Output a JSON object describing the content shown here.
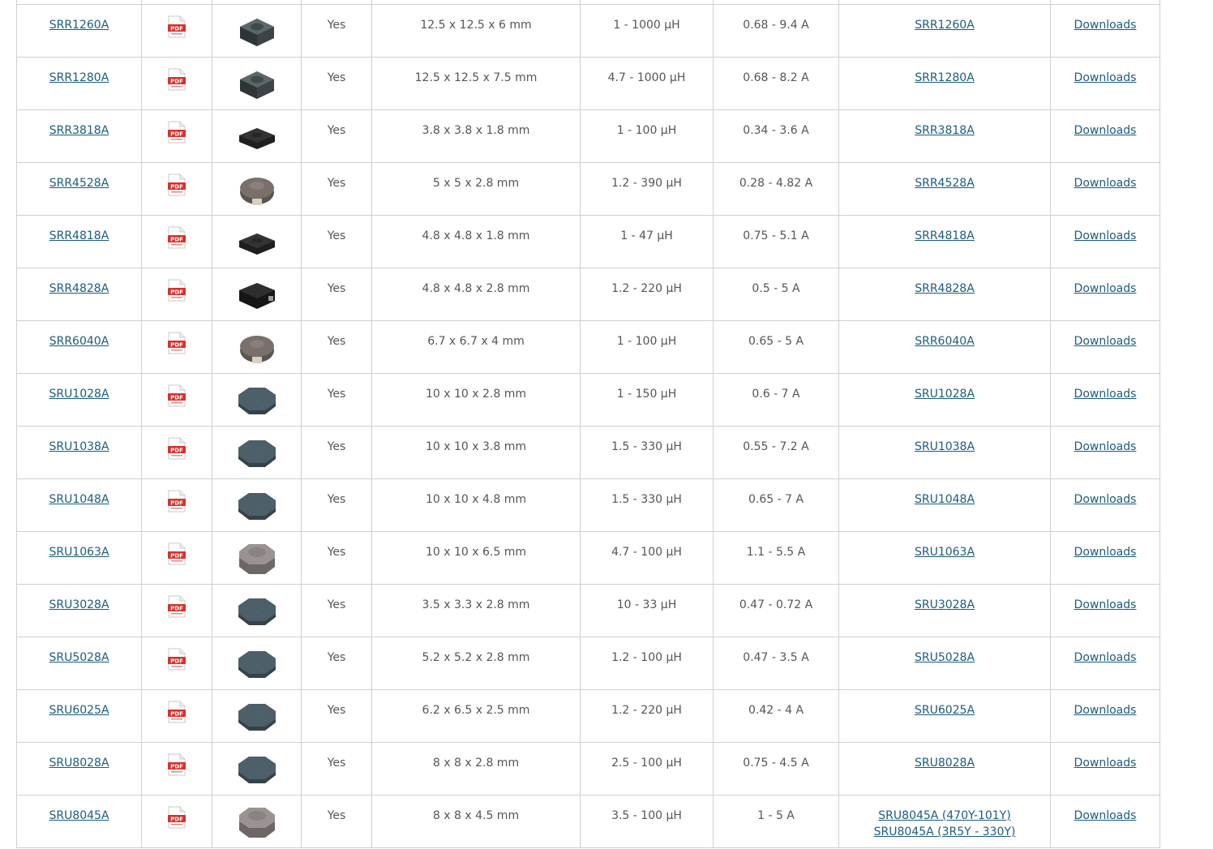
{
  "rows": [
    {
      "part": "SRR1260A",
      "aec": "Yes",
      "size": "12.5 x 12.5 x 6 mm",
      "inductance": "1 - 1000 µH",
      "current": "0.68 - 9.4 A",
      "models": [
        "SRR1260A"
      ],
      "downloads": "Downloads",
      "shape": "sq-dark"
    },
    {
      "part": "SRR1280A",
      "aec": "Yes",
      "size": "12.5 x 12.5 x 7.5 mm",
      "inductance": "4.7 - 1000 µH",
      "current": "0.68 - 8.2 A",
      "models": [
        "SRR1280A"
      ],
      "downloads": "Downloads",
      "shape": "sq-dark"
    },
    {
      "part": "SRR3818A",
      "aec": "Yes",
      "size": "3.8 x 3.8 x 1.8 mm",
      "inductance": "1 - 100 µH",
      "current": "0.34 - 3.6 A",
      "models": [
        "SRR3818A"
      ],
      "downloads": "Downloads",
      "shape": "flat-black"
    },
    {
      "part": "SRR4528A",
      "aec": "Yes",
      "size": "5 x 5 x 2.8 mm",
      "inductance": "1.2 - 390 µH",
      "current": "0.28 - 4.82 A",
      "models": [
        "SRR4528A"
      ],
      "downloads": "Downloads",
      "shape": "round-brown"
    },
    {
      "part": "SRR4818A",
      "aec": "Yes",
      "size": "4.8 x 4.8 x 1.8 mm",
      "inductance": "1 - 47 µH",
      "current": "0.75 - 5.1 A",
      "models": [
        "SRR4818A"
      ],
      "downloads": "Downloads",
      "shape": "flat-black"
    },
    {
      "part": "SRR4828A",
      "aec": "Yes",
      "size": "4.8 x 4.8 x 2.8 mm",
      "inductance": "1.2 - 220 µH",
      "current": "0.5 - 5 A",
      "models": [
        "SRR4828A"
      ],
      "downloads": "Downloads",
      "shape": "block-black"
    },
    {
      "part": "SRR6040A",
      "aec": "Yes",
      "size": "6.7 x 6.7 x 4 mm",
      "inductance": "1 - 100 µH",
      "current": "0.65 - 5 A",
      "models": [
        "SRR6040A"
      ],
      "downloads": "Downloads",
      "shape": "round-brown"
    },
    {
      "part": "SRU1028A",
      "aec": "Yes",
      "size": "10 x 10 x 2.8 mm",
      "inductance": "1 - 150 µH",
      "current": "0.6 - 7 A",
      "models": [
        "SRU1028A"
      ],
      "downloads": "Downloads",
      "shape": "oct-slate"
    },
    {
      "part": "SRU1038A",
      "aec": "Yes",
      "size": "10 x 10 x 3.8 mm",
      "inductance": "1.5 - 330 µH",
      "current": "0.55 - 7.2 A",
      "models": [
        "SRU1038A"
      ],
      "downloads": "Downloads",
      "shape": "oct-slate"
    },
    {
      "part": "SRU1048A",
      "aec": "Yes",
      "size": "10 x 10 x 4.8 mm",
      "inductance": "1.5 - 330 µH",
      "current": "0.65 - 7 A",
      "models": [
        "SRU1048A"
      ],
      "downloads": "Downloads",
      "shape": "oct-slate"
    },
    {
      "part": "SRU1063A",
      "aec": "Yes",
      "size": "10 x 10 x 6.5 mm",
      "inductance": "4.7 - 100 µH",
      "current": "1.1 - 5.5 A",
      "models": [
        "SRU1063A"
      ],
      "downloads": "Downloads",
      "shape": "oct-gray"
    },
    {
      "part": "SRU3028A",
      "aec": "Yes",
      "size": "3.5 x 3.3 x 2.8 mm",
      "inductance": "10 - 33 µH",
      "current": "0.47 - 0.72 A",
      "models": [
        "SRU3028A"
      ],
      "downloads": "Downloads",
      "shape": "oct-slate"
    },
    {
      "part": "SRU5028A",
      "aec": "Yes",
      "size": "5.2 x 5.2 x 2.8 mm",
      "inductance": "1.2 - 100 µH",
      "current": "0.47 - 3.5 A",
      "models": [
        "SRU5028A"
      ],
      "downloads": "Downloads",
      "shape": "oct-slate"
    },
    {
      "part": "SRU6025A",
      "aec": "Yes",
      "size": "6.2 x 6.5 x 2.5 mm",
      "inductance": "1.2 - 220 µH",
      "current": "0.42 - 4 A",
      "models": [
        "SRU6025A"
      ],
      "downloads": "Downloads",
      "shape": "oct-slate"
    },
    {
      "part": "SRU8028A",
      "aec": "Yes",
      "size": "8 x 8 x 2.8 mm",
      "inductance": "2.5 - 100 µH",
      "current": "0.75 - 4.5 A",
      "models": [
        "SRU8028A"
      ],
      "downloads": "Downloads",
      "shape": "oct-slate"
    },
    {
      "part": "SRU8045A",
      "aec": "Yes",
      "size": "8 x 8 x 4.5 mm",
      "inductance": "3.5 - 100 µH",
      "current": "1 - 5 A",
      "models": [
        "SRU8045A (470Y-101Y)",
        "SRU8045A (3R5Y - 330Y)"
      ],
      "downloads": "Downloads",
      "shape": "oct-gray"
    }
  ],
  "icons": {
    "pdf": "pdf-icon",
    "pdf_label": "PDF"
  },
  "colors": {
    "link": "#1b5c7e",
    "pdf_red": "#d9302c",
    "border": "#cfcfcf"
  }
}
